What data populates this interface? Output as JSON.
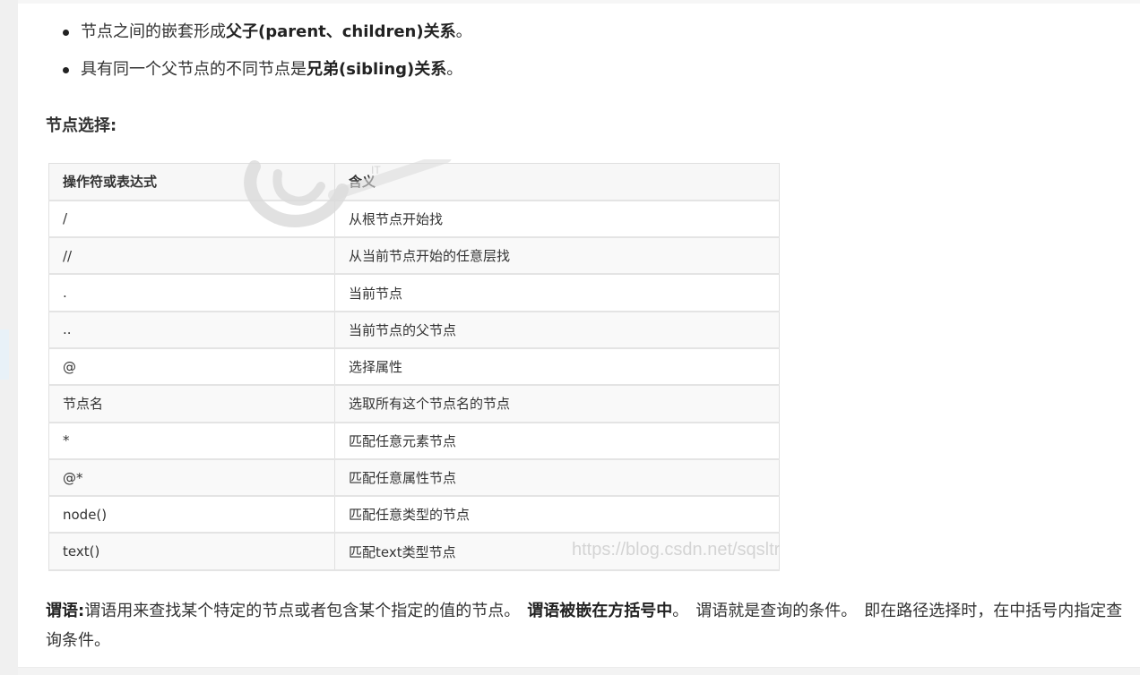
{
  "bullets": [
    {
      "before": "节点之间的嵌套形成",
      "bold": "父子(parent、children)关系",
      "after": "。"
    },
    {
      "before": "具有同一个父节点的不同节点是",
      "bold": "兄弟(sibling)关系",
      "after": "。"
    }
  ],
  "section_title": "节点选择:",
  "table": {
    "headers": [
      "操作符或表达式",
      "含义"
    ],
    "rows": [
      [
        "/",
        "从根节点开始找"
      ],
      [
        "//",
        "从当前节点开始的任意层找"
      ],
      [
        ".",
        "当前节点"
      ],
      [
        "..",
        "当前节点的父节点"
      ],
      [
        "@",
        "选择属性"
      ],
      [
        "节点名",
        "选取所有这个节点名的节点"
      ],
      [
        "*",
        "匹配任意元素节点"
      ],
      [
        "@*",
        "匹配任意属性节点"
      ],
      [
        "node()",
        "匹配任意类型的节点"
      ],
      [
        "text()",
        "匹配text类型节点"
      ]
    ]
  },
  "watermark": {
    "url": "https://blog.csdn.net/sqsltr",
    "logo_icon": "blog-logo-watermark"
  },
  "predicate": {
    "label": "谓语:",
    "text1": "谓语用来查找某个特定的节点或者包含某个指定的值的节点。",
    "bold": "谓语被嵌在方括号中",
    "text2": "。",
    "text3": "谓语就是查询的条件。",
    "text4": "即在路径选择时，在中括号内指定查询条件。"
  }
}
